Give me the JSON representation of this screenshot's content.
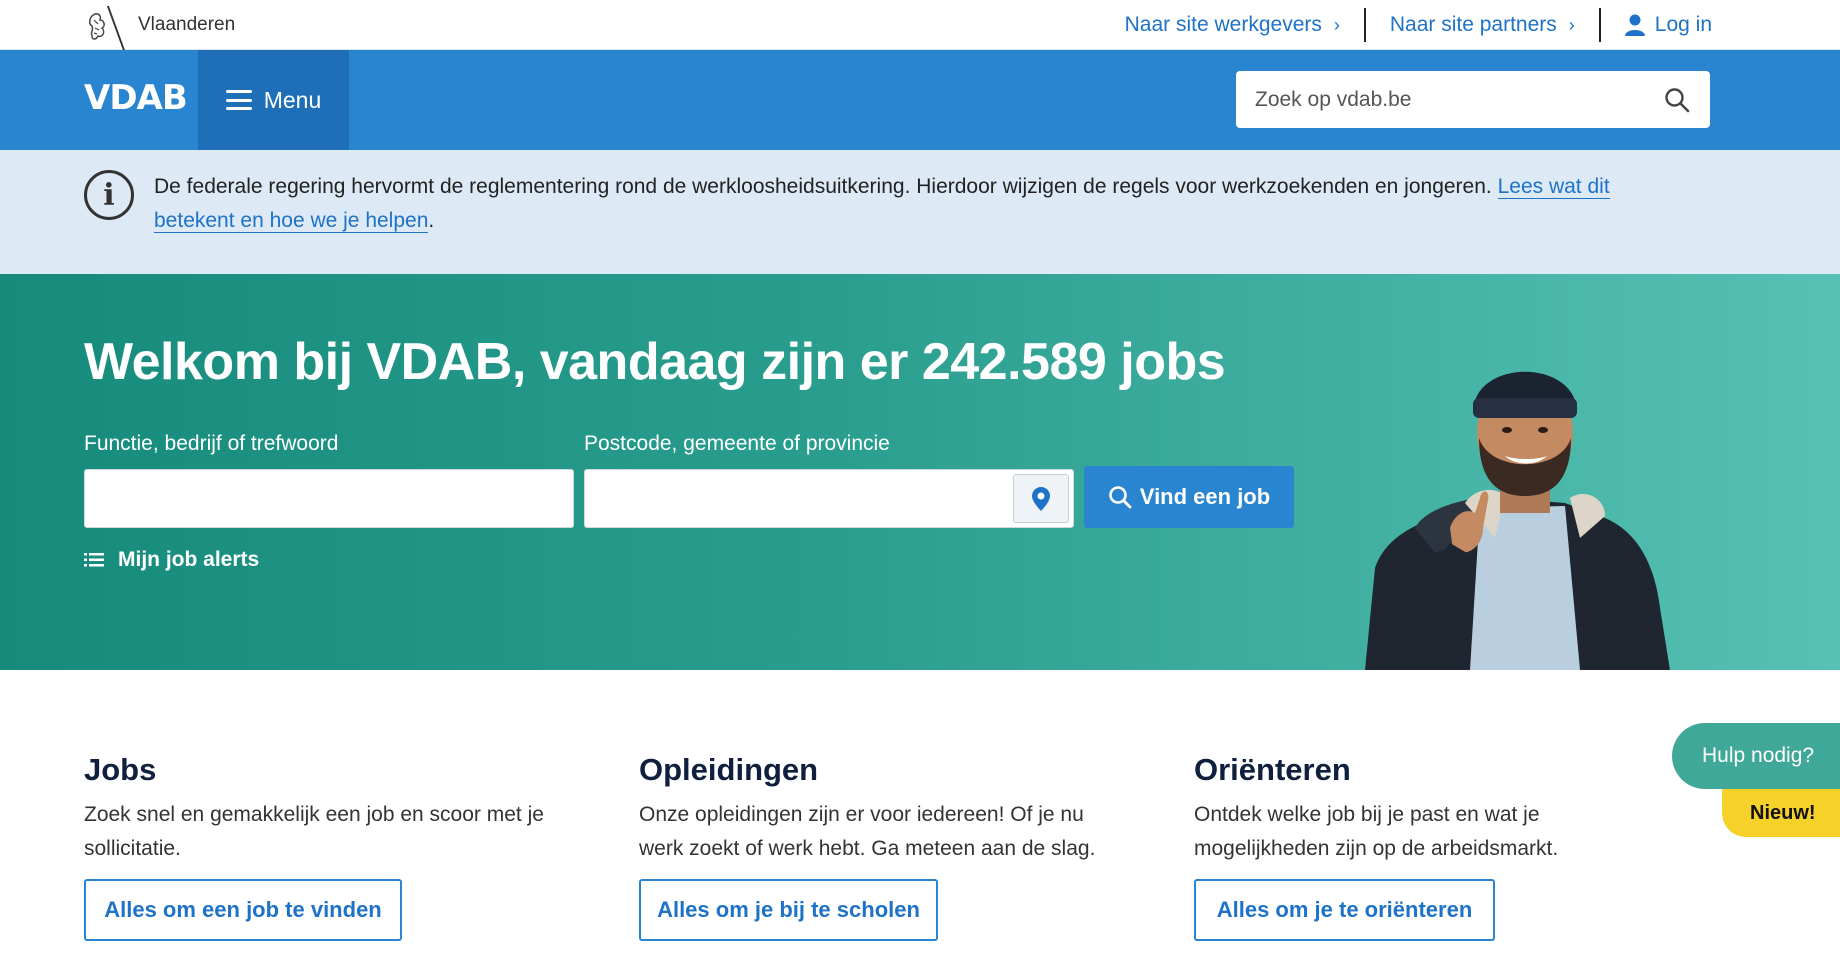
{
  "topbar": {
    "brand": "Vlaanderen",
    "links": [
      {
        "label": "Naar site werkgevers"
      },
      {
        "label": "Naar site partners"
      }
    ],
    "login_label": "Log in"
  },
  "header": {
    "logo": "VDAB",
    "menu_label": "Menu",
    "search_placeholder": "Zoek op vdab.be"
  },
  "banner": {
    "text": "De federale regering hervormt de reglementering rond de werkloosheidsuitkering. Hierdoor wijzigen de regels voor werkzoekenden en jongeren. ",
    "link": "Lees wat dit betekent en hoe we je helpen",
    "end": "."
  },
  "hero": {
    "title": "Welkom bij VDAB, vandaag zijn er 242.589 jobs",
    "keyword_label": "Functie, bedrijf of trefwoord",
    "location_label": "Postcode, gemeente of provincie",
    "keyword_value": "",
    "location_value": "",
    "find_button": "Vind een job",
    "alerts_label": "Mijn job alerts"
  },
  "sections": [
    {
      "title": "Jobs",
      "text": "Zoek snel en gemakkelijk een job en scoor met je sollicitatie.",
      "button": "Alles om een job te vinden"
    },
    {
      "title": "Opleidingen",
      "text": "Onze opleidingen zijn er voor iedereen! Of je nu werk zoekt of werk hebt. Ga meteen aan de slag.",
      "button": "Alles om je bij te scholen"
    },
    {
      "title": "Oriënteren",
      "text": "Ontdek welke job bij je past en wat je mogelijkheden zijn op de arbeidsmarkt.",
      "button": "Alles om je te oriënteren"
    }
  ],
  "help": {
    "label": "Hulp nodig?",
    "badge": "Nieuw!"
  },
  "colors": {
    "brand_blue": "#2a85d0",
    "hero_teal": "#2a9e8e",
    "banner_bg": "#ddeaf6",
    "badge_yellow": "#f6d12a"
  }
}
